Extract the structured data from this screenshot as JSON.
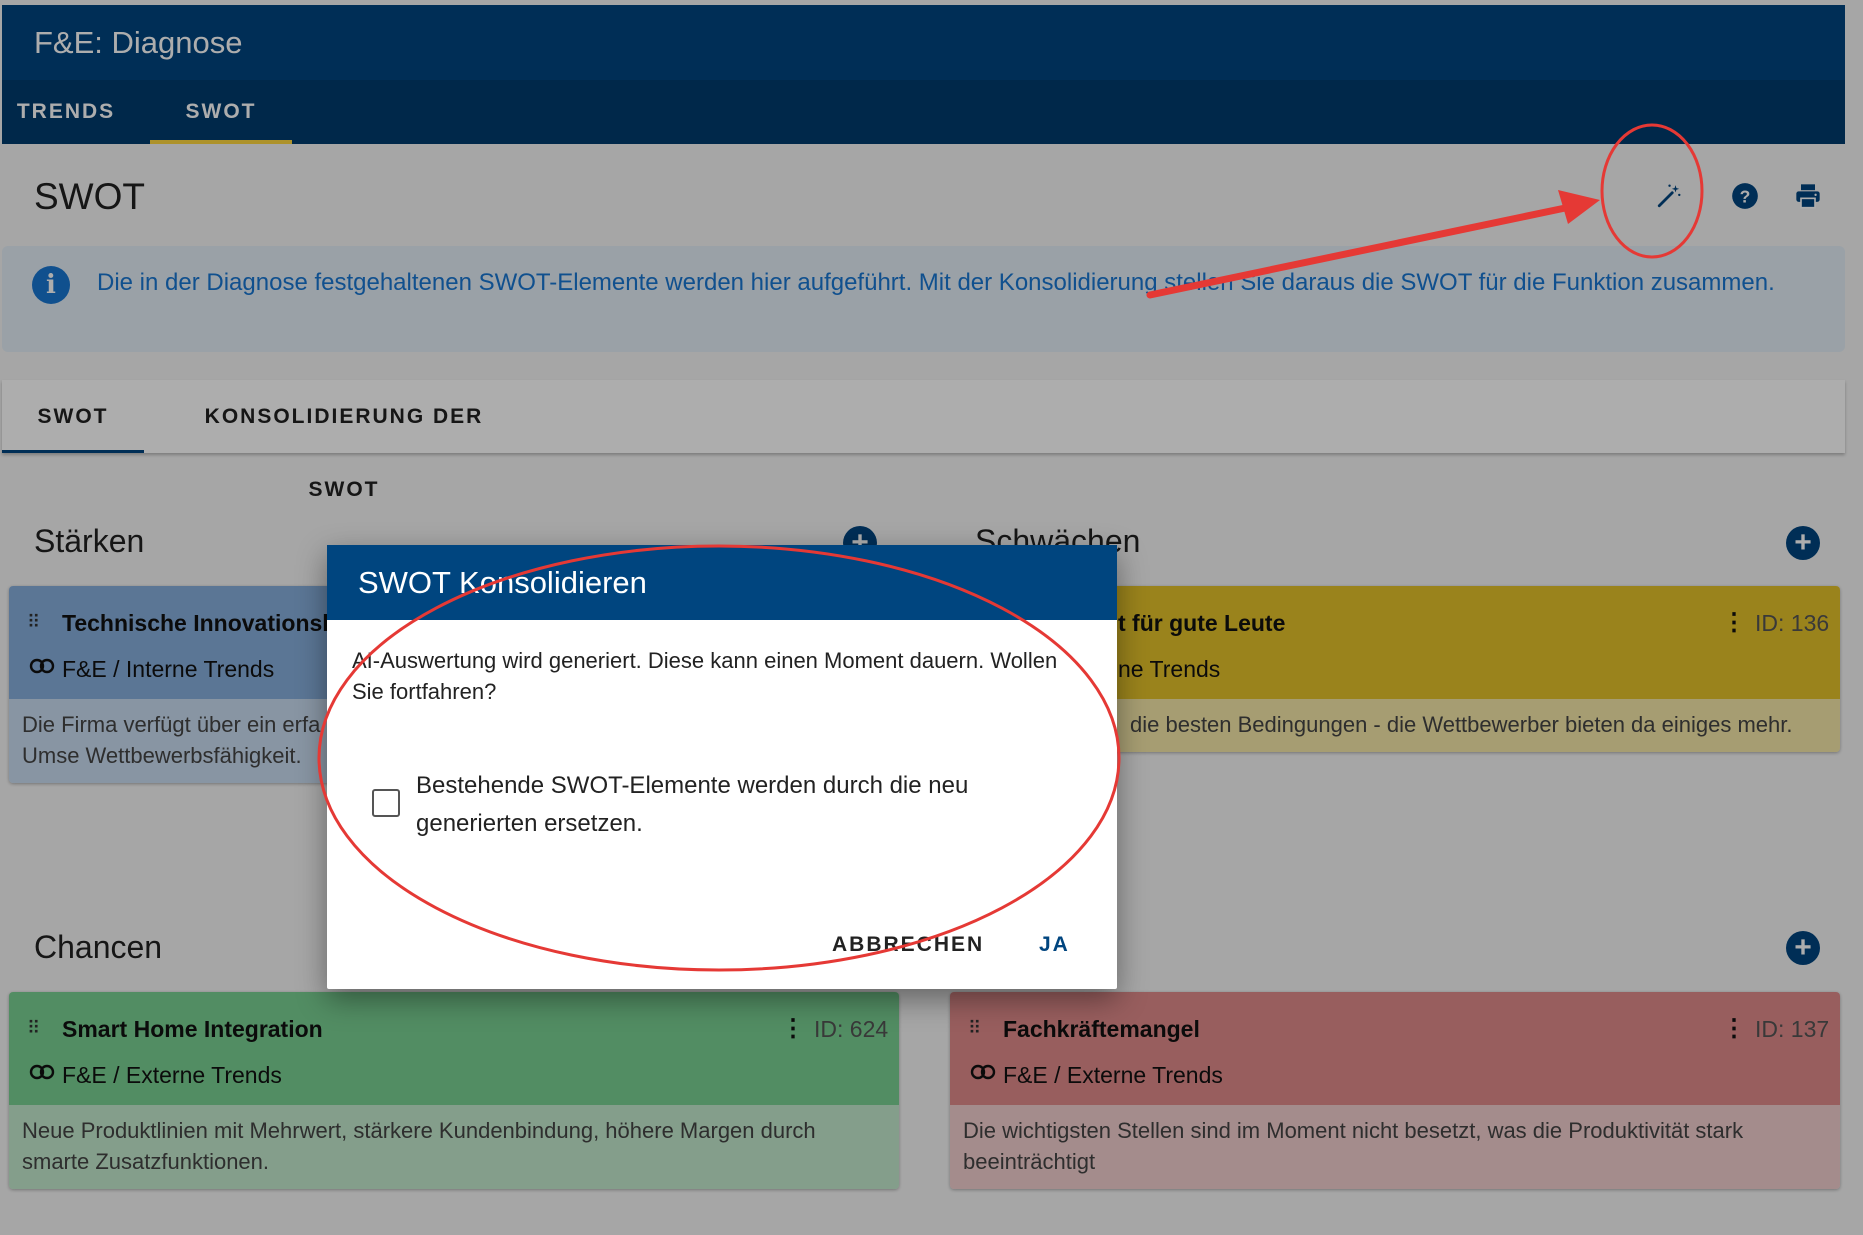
{
  "app": {
    "title": "F&E: Diagnose",
    "tabs": [
      {
        "label": "TRENDS",
        "active": false
      },
      {
        "label": "SWOT",
        "active": true
      }
    ]
  },
  "page": {
    "title": "SWOT",
    "toolbar": {
      "icons": [
        "magic-wand-icon",
        "help-icon",
        "print-icon"
      ]
    }
  },
  "info": {
    "icon": "info-icon",
    "text": "Die in der Diagnose festgehaltenen SWOT-Elemente werden hier aufgeführt. Mit der Konsolidierung stellen Sie daraus die SWOT für die Funktion zusammen."
  },
  "subtabs": [
    {
      "label": "SWOT",
      "active": true
    },
    {
      "label": "KONSOLIDIERUNG DER SWOT",
      "active": false
    }
  ],
  "sections": {
    "strengths": {
      "title": "Stärken",
      "card": {
        "title": "Technische Innovationskr",
        "source": "F&E / Interne Trends",
        "text": "Die Firma verfügt über ein erfa elektronische Zusatzfunktione ermöglicht eine schnelle Umse Wettbewerbsfähigkeit.",
        "color": "#86aedc"
      }
    },
    "weaknesses": {
      "title": "Schwächen",
      "card": {
        "title": "t für gute Leute",
        "id": "ID: 136",
        "source": "ne Trends",
        "text": "die besten Bedingungen - die Wettbewerber bieten da einiges mehr.",
        "color": "#e4c22a"
      }
    },
    "opportunities": {
      "title": "Chancen",
      "card": {
        "title": "Smart Home Integration",
        "id": "ID: 624",
        "source": "F&E / Externe Trends",
        "text": "Neue Produktlinien mit Mehrwert, stärkere Kundenbindung, höhere Margen durch smarte Zusatzfunktionen.",
        "color": "#79d092"
      }
    },
    "threats": {
      "card": {
        "title": "Fachkräftemangel",
        "id": "ID: 137",
        "source": "F&E / Externe Trends",
        "text": "Die wichtigsten Stellen sind im Moment nicht besetzt, was die Produktivität stark beeinträchtigt",
        "color": "#e08b8b"
      }
    }
  },
  "dialog": {
    "title": "SWOT Konsolidieren",
    "message": "AI-Auswertung wird generiert. Diese kann einen Moment dauern. Wollen Sie fortfahren?",
    "checkbox_label": "Bestehende SWOT-Elemente werden durch die neu generierten ersetzen.",
    "checkbox_checked": false,
    "cancel_label": "ABBRECHEN",
    "confirm_label": "JA"
  },
  "colors": {
    "primary": "#00457f",
    "tab_indicator": "#ffd740",
    "info_text": "#1976d2",
    "annotation": "#e53935"
  }
}
